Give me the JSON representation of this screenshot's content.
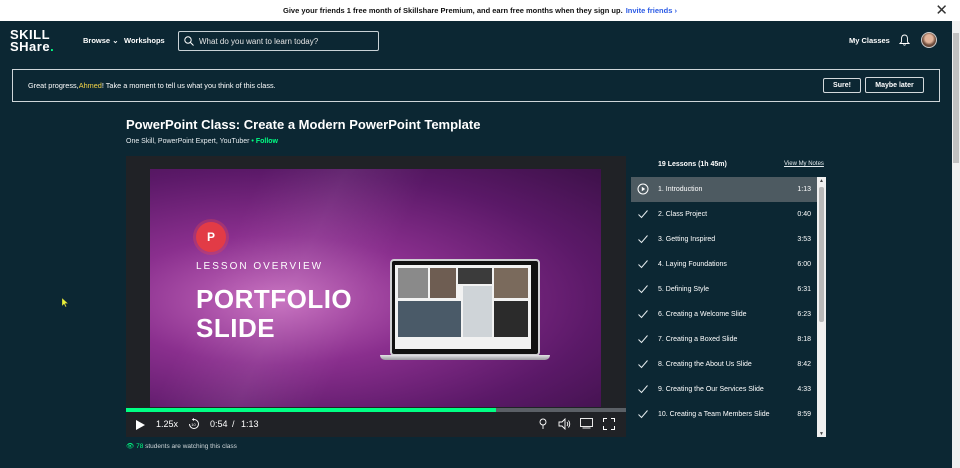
{
  "promo": {
    "text": "Give your friends 1 free month of Skillshare Premium, and earn free months when they sign up.",
    "link": "Invite friends"
  },
  "header": {
    "logo_line1": "SKILL",
    "logo_line2": "SHare",
    "logo_dot": ".",
    "browse": "Browse",
    "workshops": "Workshops",
    "search_placeholder": "What do you want to learn today?",
    "my_classes": "My Classes"
  },
  "feedback": {
    "prefix": "Great progress, ",
    "name": "Ahmed",
    "suffix": "! Take a moment to tell us what you think of this class.",
    "sure": "Sure!",
    "later": "Maybe later"
  },
  "class": {
    "title": "PowerPoint Class: Create a Modern PowerPoint Template",
    "teacher": "One Skill, PowerPoint Expert, YouTuber",
    "bullet": " • ",
    "follow": "Follow"
  },
  "video": {
    "badge": "P",
    "overview": "LESSON OVERVIEW",
    "line1": "PORTFOLIO",
    "line2": "SLIDE",
    "speed": "1.25x",
    "current_time": "0:54",
    "separator": "/",
    "duration": "1:13",
    "progress": 0.74
  },
  "watching": {
    "count": "78",
    "text": " students are watching this class"
  },
  "lessons": {
    "header": "19 Lessons (1h 45m)",
    "notes_link": "View My Notes",
    "items": [
      {
        "title": "1. Introduction",
        "duration": "1:13",
        "state": "playing"
      },
      {
        "title": "2. Class Project",
        "duration": "0:40",
        "state": "done"
      },
      {
        "title": "3. Getting Inspired",
        "duration": "3:53",
        "state": "done"
      },
      {
        "title": "4. Laying Foundations",
        "duration": "6:00",
        "state": "done"
      },
      {
        "title": "5. Defining Style",
        "duration": "6:31",
        "state": "done"
      },
      {
        "title": "6. Creating a Welcome Slide",
        "duration": "6:23",
        "state": "done"
      },
      {
        "title": "7. Creating a Boxed Slide",
        "duration": "8:18",
        "state": "done"
      },
      {
        "title": "8. Creating the About Us Slide",
        "duration": "8:42",
        "state": "done"
      },
      {
        "title": "9. Creating the Our Services Slide",
        "duration": "4:33",
        "state": "done"
      },
      {
        "title": "10. Creating a Team Members Slide",
        "duration": "8:59",
        "state": "done"
      }
    ]
  },
  "colors": {
    "background": "#0c2733",
    "accent": "#00ff84",
    "name_highlight": "#f5d547",
    "active_lesson": "#4d5a61"
  }
}
